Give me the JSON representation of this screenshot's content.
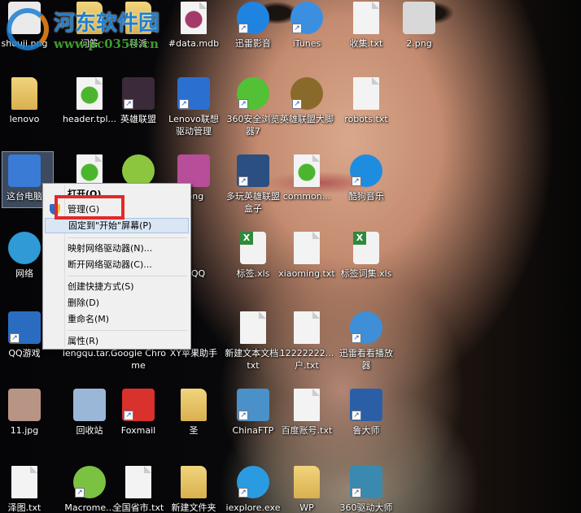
{
  "watermark": {
    "title": "河东软件园",
    "url": "www.pc0359.cn"
  },
  "desktop": {
    "columns": [
      [
        {
          "label": "shouji.png",
          "type": "img",
          "color": "#eaeaea"
        },
        {
          "label": "lenovo",
          "type": "folder"
        },
        {
          "label": "这台电脑",
          "type": "pc",
          "color": "#3a7bd5"
        },
        {
          "label": "网络",
          "type": "round",
          "color": "#2f9ad6"
        },
        {
          "label": "QQ游戏",
          "type": "img",
          "color": "#2a6dc0",
          "shortcut": true
        },
        {
          "label": "11.jpg",
          "type": "img",
          "color": "#b89484"
        },
        {
          "label": "泽图.txt",
          "type": "file"
        }
      ],
      [
        {
          "label": "问答",
          "type": "folder"
        },
        {
          "label": "header.tpl...",
          "type": "file",
          "color": "#4bb52e"
        },
        {
          "label": "",
          "type": "file",
          "color": "#4bb52e"
        },
        {
          "label": "",
          "type": "none"
        },
        {
          "label": "lengqu.tar...",
          "type": "none"
        },
        {
          "label": "回收站",
          "type": "img",
          "color": "#9ab7d8"
        },
        {
          "label": "Macrome...",
          "type": "round",
          "color": "#7cc242",
          "shortcut": true
        }
      ],
      [
        {
          "label": "科派",
          "type": "folder"
        },
        {
          "label": "英雄联盟",
          "type": "img",
          "color": "#3b2a3a",
          "shortcut": true
        },
        {
          "label": "",
          "type": "round",
          "color": "#8cc63f"
        },
        {
          "label": "",
          "type": "none"
        },
        {
          "label": "Google Chrome",
          "type": "none"
        },
        {
          "label": "Foxmail",
          "type": "img",
          "color": "#d9312b",
          "shortcut": true
        },
        {
          "label": "全国省市.txt",
          "type": "file"
        }
      ],
      [
        {
          "label": "#data.mdb",
          "type": "file",
          "color": "#a33a6a"
        },
        {
          "label": "Lenovo联想驱动管理",
          "type": "img",
          "color": "#2b6fd1",
          "shortcut": true
        },
        {
          "label": ".png",
          "type": "img",
          "color": "#b84d9a"
        },
        {
          "label": "讯QQ",
          "type": "none"
        },
        {
          "label": "XY苹果助手",
          "type": "none"
        },
        {
          "label": "圣",
          "type": "folder"
        },
        {
          "label": "新建文件夹",
          "type": "folder"
        }
      ],
      [
        {
          "label": "迅雷影音",
          "type": "round",
          "color": "#1f84e0",
          "shortcut": true
        },
        {
          "label": "360安全浏览器7",
          "type": "round",
          "color": "#52c135",
          "shortcut": true
        },
        {
          "label": "多玩英雄联盟盒子",
          "type": "img",
          "color": "#2b4f80",
          "shortcut": true
        },
        {
          "label": "标签.xls",
          "type": "xls"
        },
        {
          "label": "新建文本文档.txt",
          "type": "file"
        },
        {
          "label": "ChinaFTP",
          "type": "img",
          "color": "#4a90c9",
          "shortcut": true
        },
        {
          "label": "iexplore.exe",
          "type": "round",
          "color": "#2a9be0",
          "shortcut": true
        }
      ],
      [
        {
          "label": "iTunes",
          "type": "round",
          "color": "#3b8fe0",
          "shortcut": true
        },
        {
          "label": "英雄联盟大脚",
          "type": "round",
          "color": "#8a6a2a",
          "shortcut": true
        },
        {
          "label": "common...",
          "type": "file",
          "color": "#4bb52e"
        },
        {
          "label": "xiaoming.txt",
          "type": "file"
        },
        {
          "label": "12222222...户.txt",
          "type": "file"
        },
        {
          "label": "百度账号.txt",
          "type": "file"
        },
        {
          "label": "WP",
          "type": "folder"
        }
      ],
      [
        {
          "label": "收集.txt",
          "type": "file"
        },
        {
          "label": "robots.txt",
          "type": "file"
        },
        {
          "label": "酷狗音乐",
          "type": "round",
          "color": "#1e8de0",
          "shortcut": true
        },
        {
          "label": "标签词集.xls",
          "type": "xls"
        },
        {
          "label": "迅雷看看播放器",
          "type": "round",
          "color": "#3e8fd8",
          "shortcut": true
        },
        {
          "label": "鲁大师",
          "type": "img",
          "color": "#2a5fa8",
          "shortcut": true
        },
        {
          "label": "360驱动大师",
          "type": "img",
          "color": "#3a8ab0",
          "shortcut": true
        }
      ],
      [
        {
          "label": "2.png",
          "type": "img",
          "color": "#d8d8d8"
        }
      ]
    ]
  },
  "context_menu": {
    "items": [
      {
        "label": "打开(O)",
        "bold": true
      },
      {
        "label": "管理(G)",
        "icon": "shield-icon"
      },
      {
        "label": "固定到\"开始\"屏幕(P)",
        "highlighted": true
      },
      {
        "label": "映射网络驱动器(N)..."
      },
      {
        "label": "断开网络驱动器(C)..."
      },
      {
        "label": "创建快捷方式(S)"
      },
      {
        "label": "删除(D)"
      },
      {
        "label": "重命名(M)"
      },
      {
        "label": "属性(R)"
      }
    ]
  },
  "highlight_color": "#e02a2a"
}
